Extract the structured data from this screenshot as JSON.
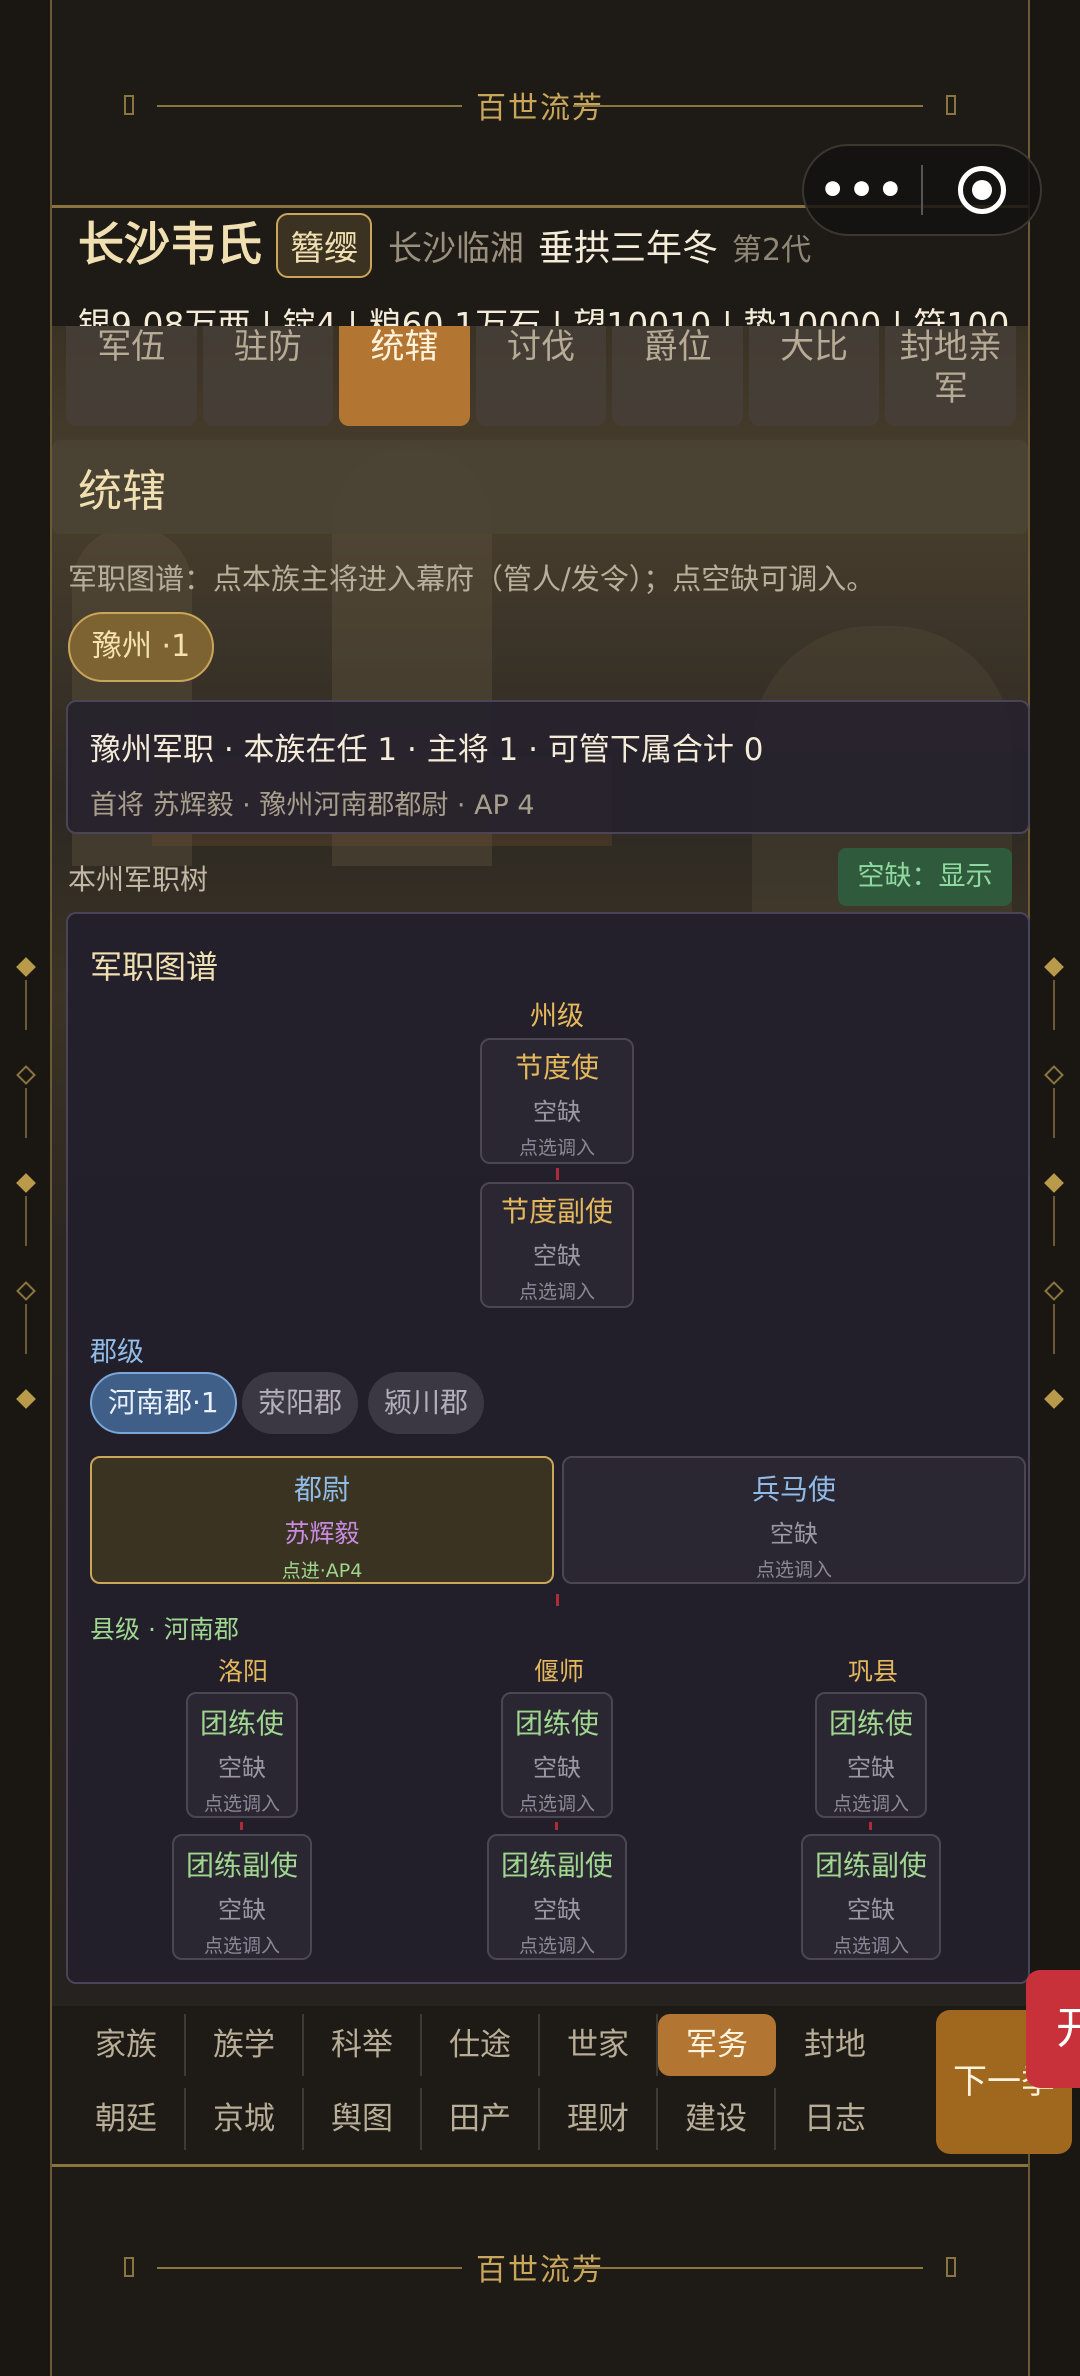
{
  "banner": {
    "top_text": "百世流芳",
    "bottom_text": "百世流芳"
  },
  "header": {
    "clan_name": "长沙韦氏",
    "badge": "簪缨",
    "place": "长沙临湘",
    "date": "垂拱三年冬",
    "generation": "第2代",
    "resources": "银9.08万两 | 锭4 | 粮60.1万石 | 望10010 | 势10000 | 符100"
  },
  "tabs": [
    {
      "label": "军伍",
      "active": false
    },
    {
      "label": "驻防",
      "active": false
    },
    {
      "label": "统辖",
      "active": true
    },
    {
      "label": "讨伐",
      "active": false
    },
    {
      "label": "爵位",
      "active": false
    },
    {
      "label": "大比",
      "active": false
    },
    {
      "label": "封地亲军",
      "active": false
    }
  ],
  "section": {
    "title": "统辖",
    "hint": "军职图谱：点本族主将进入幕府（管人/发令）；点空缺可调入。",
    "province_pill": "豫州 ·1"
  },
  "info": {
    "line1": "豫州军职 · 本族在任 1 · 主将 1 · 可管下属合计 0",
    "line2": "首将 苏辉毅 · 豫州河南郡都尉 · AP 4"
  },
  "tree": {
    "label": "本州军职树",
    "vacant_toggle": "空缺：显示",
    "chart_title": "军职图谱",
    "state_level": "州级",
    "state_slots": [
      {
        "title": "节度使",
        "status": "空缺",
        "action": "点选调入"
      },
      {
        "title": "节度副使",
        "status": "空缺",
        "action": "点选调入"
      }
    ],
    "commandery_level": "郡级",
    "commanderies": [
      "河南郡·1",
      "荥阳郡",
      "颍川郡"
    ],
    "commandery_slots": [
      {
        "title": "都尉",
        "occupant": "苏辉毅",
        "action": "点进·AP4"
      },
      {
        "title": "兵马使",
        "status": "空缺",
        "action": "点选调入"
      }
    ],
    "county_level": "县级 · 河南郡",
    "counties": [
      {
        "name": "洛阳",
        "slots": [
          {
            "title": "团练使",
            "status": "空缺",
            "action": "点选调入"
          },
          {
            "title": "团练副使",
            "status": "空缺",
            "action": "点选调入"
          }
        ]
      },
      {
        "name": "偃师",
        "slots": [
          {
            "title": "团练使",
            "status": "空缺",
            "action": "点选调入"
          },
          {
            "title": "团练副使",
            "status": "空缺",
            "action": "点选调入"
          }
        ]
      },
      {
        "name": "巩县",
        "slots": [
          {
            "title": "团练使",
            "status": "空缺",
            "action": "点选调入"
          },
          {
            "title": "团练副使",
            "status": "空缺",
            "action": "点选调入"
          }
        ]
      }
    ]
  },
  "nav": {
    "row1": [
      "家族",
      "族学",
      "科举",
      "仕途",
      "世家",
      "军务",
      "封地"
    ],
    "row2": [
      "朝廷",
      "京城",
      "舆图",
      "田产",
      "理财",
      "建设",
      "日志"
    ],
    "active": "军务",
    "next_button": "下一季",
    "floating_tab": "开"
  }
}
